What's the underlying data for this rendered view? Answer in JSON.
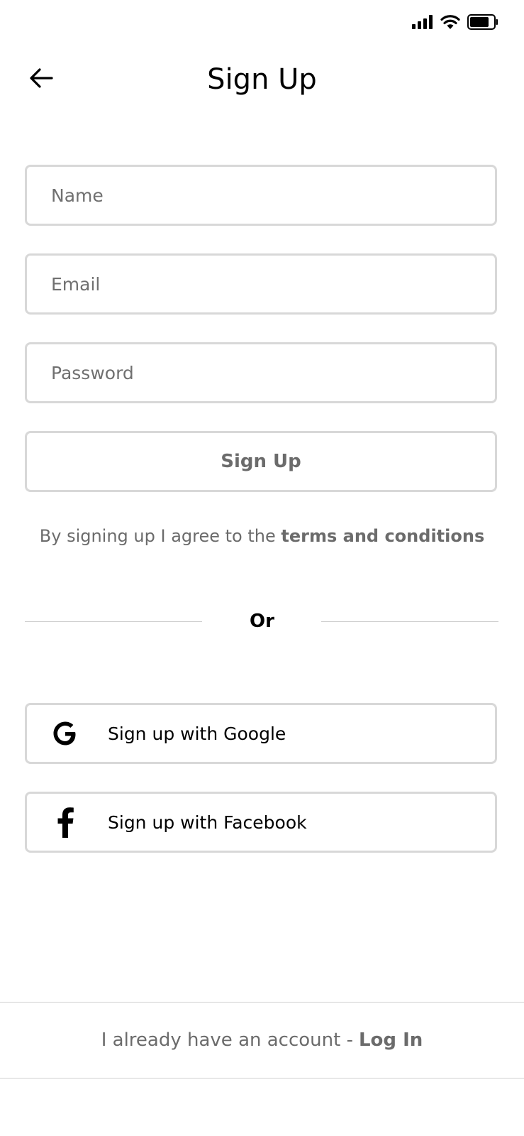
{
  "status_bar": {
    "icons": [
      "signal-icon",
      "wifi-icon",
      "battery-icon"
    ]
  },
  "header": {
    "back_icon": "arrow-left-icon",
    "title": "Sign Up"
  },
  "form": {
    "name_placeholder": "Name",
    "name_value": "",
    "email_placeholder": "Email",
    "email_value": "",
    "password_placeholder": "Password",
    "password_value": "",
    "submit_label": "Sign Up"
  },
  "terms": {
    "prefix": "By signing up I agree to the",
    "link": "terms and conditions"
  },
  "divider": {
    "label": "Or"
  },
  "social": {
    "google_icon": "google-icon",
    "google_label": "Sign up with Google",
    "facebook_icon": "facebook-icon",
    "facebook_label": "Sign up with Facebook"
  },
  "footer": {
    "prefix": "I already have an account -",
    "link": "Log In"
  },
  "colors": {
    "border": "#d8d8d8",
    "muted_text": "#6b6b6b",
    "text": "#000000",
    "background": "#ffffff"
  }
}
